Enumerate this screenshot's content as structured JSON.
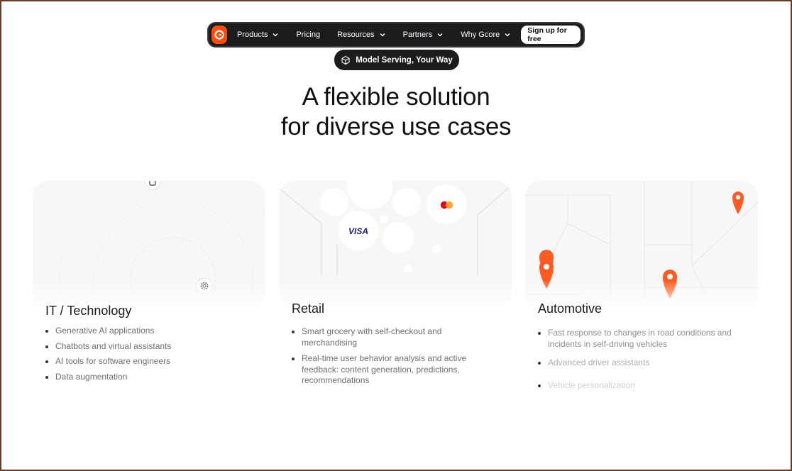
{
  "nav": {
    "items": [
      {
        "label": "Products",
        "has_chevron": true
      },
      {
        "label": "Pricing",
        "has_chevron": false
      },
      {
        "label": "Resources",
        "has_chevron": true
      },
      {
        "label": "Partners",
        "has_chevron": true
      },
      {
        "label": "Why Gcore",
        "has_chevron": true
      }
    ],
    "cta": "Sign up for free"
  },
  "pill": {
    "label": "Model Serving, Your Way"
  },
  "heading": {
    "line1": "A flexible solution",
    "line2": "for diverse use cases"
  },
  "cards": [
    {
      "title": "IT / Technology",
      "bullets": [
        "Generative AI applications",
        "Chatbots and virtual assistants",
        "AI tools for software engineers",
        "Data augmentation"
      ]
    },
    {
      "title": "Retail",
      "bullets": [
        "Smart grocery with self-checkout and merchandising",
        "Real-time user behavior analysis and active feedback: content generation, predictions, recommendations"
      ],
      "visa_label": "VISA"
    },
    {
      "title": "Automotive",
      "bullets": [
        "Fast response to changes in road conditions and incidents in self-driving vehicles",
        "Advanced driver assistants",
        "Vehicle personalization"
      ]
    }
  ],
  "colors": {
    "accent": "#ff4c0d",
    "dark": "#1c1c1e",
    "visa": "#1a1f71",
    "mastercard_red": "#eb001b",
    "mastercard_orange": "#f79e1b"
  },
  "icons": [
    "gcore-logo-icon",
    "chevron-down-icon",
    "cube-icon",
    "gear-icon",
    "chip-icon",
    "visa-logo-icon",
    "mastercard-logo-icon",
    "map-pin-icon"
  ]
}
